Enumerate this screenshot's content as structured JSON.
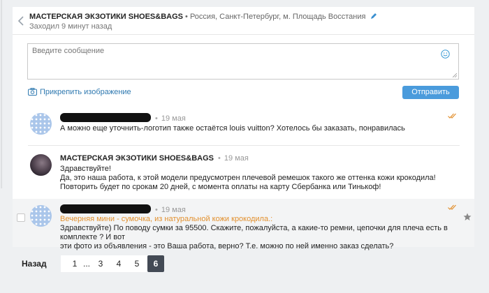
{
  "header": {
    "title": "МАСТЕРСКАЯ ЭКЗОТИКИ SHOES&BAGS",
    "location": "• Россия, Санкт-Петербург, м. Площадь Восстания",
    "last_seen": "Заходил 9 минут назад"
  },
  "composer": {
    "placeholder": "Введите сообщение",
    "attach_label": "Прикрепить изображение",
    "send_label": "Отправить"
  },
  "messages": [
    {
      "author": "",
      "date": "19 мая",
      "text": "А можно еще уточнить-логотип также остаётся louis vuitton? Хотелось бы заказать, понравилась",
      "read": true
    },
    {
      "author": "МАСТЕРСКАЯ ЭКЗОТИКИ SHOES&BAGS",
      "date": "19 мая",
      "text": "Здравствуйте!\nДа, это наша работа, к этой модели предусмотрен плечевой ремешок такого же оттенка кожи крокодила!\nПовторить будет по срокам 20 дней, с момента оплаты на карту Сбербанка или Тинькоф!"
    },
    {
      "author": "",
      "date": "19 мая",
      "link": "Вечерняя мини - сумочка, из натуральной кожи крокодила.:",
      "text": "Здравствуйте) По поводу сумки за 95500. Скажите, пожалуйста, а какие-то ремни, цепочки для плеча есть в комплекте ? И вот\nэти фото из объявления - это Ваша работа, верно? Т.е. можно по ней именно заказ сделать?",
      "read": true
    }
  ],
  "pagination": {
    "prev_label": "Назад",
    "pages": [
      "1",
      "...",
      "3",
      "4",
      "5",
      "6"
    ],
    "active": "6"
  },
  "colors": {
    "accent": "#4a9bdc",
    "link": "#2f79b0",
    "highlight_link": "#e2902e",
    "read_check": "#e2902e"
  }
}
